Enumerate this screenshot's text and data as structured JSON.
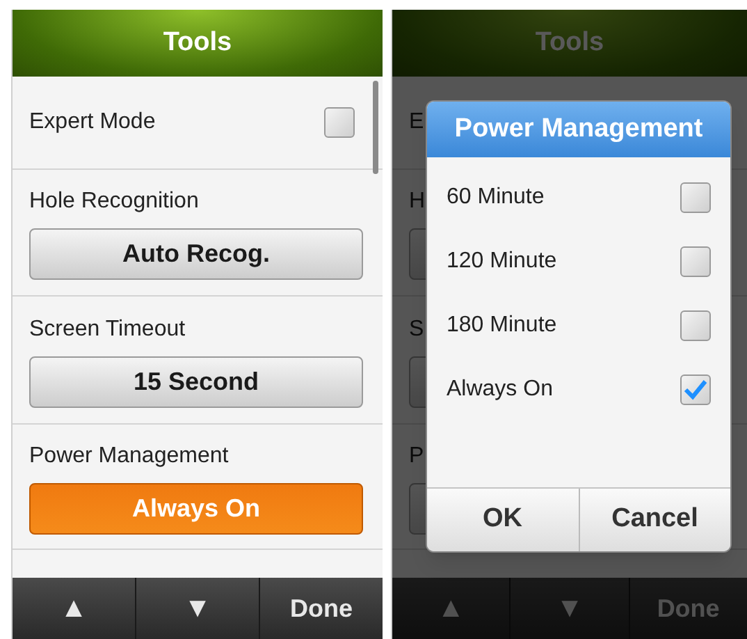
{
  "screens": [
    {
      "dimmed": false,
      "title": "Tools",
      "settings": [
        {
          "kind": "checkbox",
          "label": "Expert Mode",
          "checked": false
        },
        {
          "kind": "button",
          "label": "Hole Recognition",
          "value": "Auto Recog.",
          "highlighted": false
        },
        {
          "kind": "button",
          "label": "Screen Timeout",
          "value": "15 Second",
          "highlighted": false
        },
        {
          "kind": "button",
          "label": "Power Management",
          "value": "Always On",
          "highlighted": true
        }
      ],
      "nav": [
        "▲",
        "▼",
        "Done"
      ]
    },
    {
      "dimmed": true,
      "title": "Tools",
      "settings": [
        {
          "kind": "label",
          "label": "E"
        },
        {
          "kind": "button",
          "label": "H"
        },
        {
          "kind": "button",
          "label": "S"
        },
        {
          "kind": "button",
          "label": "P"
        }
      ],
      "nav": [
        "▲",
        "▼",
        "Done"
      ],
      "dialog": {
        "title": "Power Management",
        "options": [
          {
            "label": "60 Minute",
            "checked": false
          },
          {
            "label": "120 Minute",
            "checked": false
          },
          {
            "label": "180 Minute",
            "checked": false
          },
          {
            "label": "Always On",
            "checked": true
          }
        ],
        "buttons": [
          "OK",
          "Cancel"
        ]
      }
    }
  ]
}
